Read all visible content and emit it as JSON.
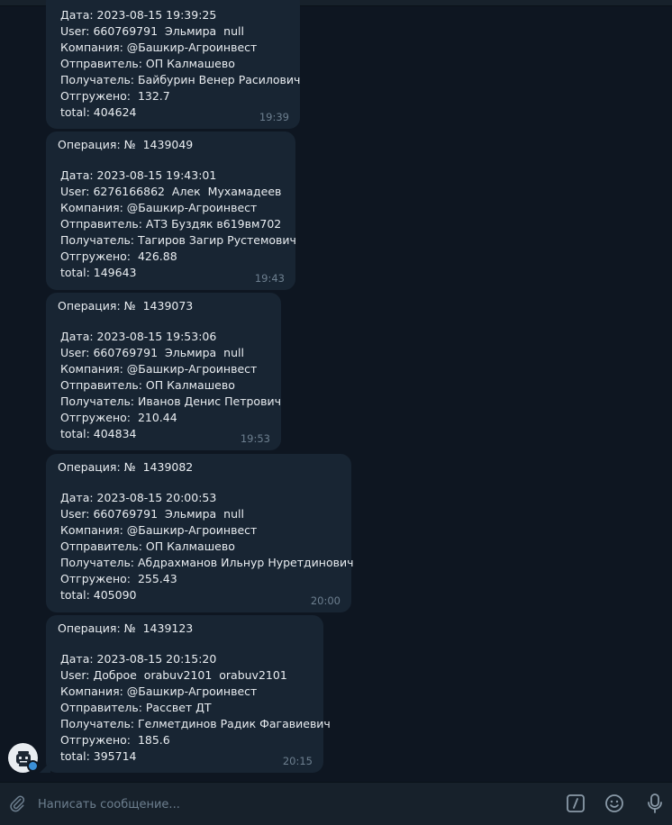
{
  "composer": {
    "placeholder": "Написать сообщение...",
    "icons": [
      "paperclip-icon",
      "slash-commands-icon",
      "emoji-icon",
      "microphone-icon"
    ]
  },
  "colors": {
    "background": "#0e1621",
    "bubble": "#182533",
    "text": "#e9edf1",
    "time": "#6d7f8f",
    "input_bar": "#17212b"
  },
  "messages": [
    {
      "lines": [
        "Дата: 2023-08-15 19:39:25",
        "User: 660769791  Эльмира  null",
        "Компания: @Башкир-Агроинвест",
        "Отправитель: ОП Калмашево",
        "Получатель: Байбурин Венер Расилович",
        "Отгружено:  132.7",
        "total: 404624"
      ],
      "time": "19:39"
    },
    {
      "operation": "Операция: №  1439049",
      "lines": [
        "Дата: 2023-08-15 19:43:01",
        "User: 6276166862  Алек  Мухамадеев",
        "Компания: @Башкир-Агроинвест",
        "Отправитель: АТЗ Буздяк в619вм702",
        "Получатель: Тагиров Загир Рустемович",
        "Отгружено:  426.88",
        "total: 149643"
      ],
      "time": "19:43"
    },
    {
      "operation": "Операция: №  1439073",
      "lines": [
        "Дата: 2023-08-15 19:53:06",
        "User: 660769791  Эльмира  null",
        "Компания: @Башкир-Агроинвест",
        "Отправитель: ОП Калмашево",
        "Получатель: Иванов Денис Петрович",
        "Отгружено:  210.44",
        "total: 404834"
      ],
      "time": "19:53"
    },
    {
      "operation": "Операция: №  1439082",
      "lines": [
        "Дата: 2023-08-15 20:00:53",
        "User: 660769791  Эльмира  null",
        "Компания: @Башкир-Агроинвест",
        "Отправитель: ОП Калмашево",
        "Получатель: Абдрахманов Ильнур Нуретдинович",
        "Отгружено:  255.43",
        "total: 405090"
      ],
      "time": "20:00"
    },
    {
      "operation": "Операция: №  1439123",
      "lines": [
        "Дата: 2023-08-15 20:15:20",
        "User: Доброе  orabuv2101  orabuv2101",
        "Компания: @Башкир-Агроинвест",
        "Отправитель: Рассвет ДТ",
        "Получатель: Гелметдинов Радик Фагавиевич",
        "Отгружено:  185.6",
        "total: 395714"
      ],
      "time": "20:15"
    }
  ]
}
